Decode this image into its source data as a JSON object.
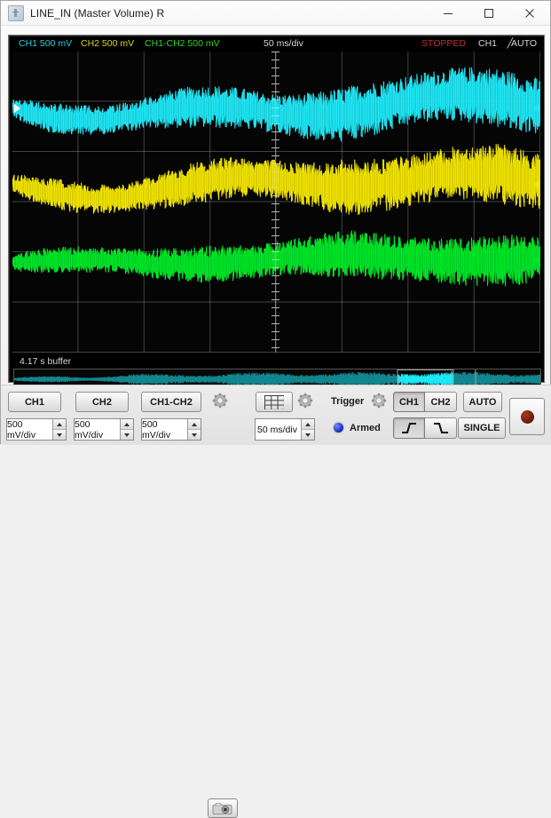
{
  "window": {
    "title": "LINE_IN (Master Volume) R",
    "icon": "app-icon",
    "minimize": "−",
    "maximize": "□",
    "close": "✕"
  },
  "scope": {
    "readout": {
      "ch1": "CH1 500 mV",
      "ch2": "CH2 500 mV",
      "diff": "CH1-CH2 500 mV",
      "timebase": "50 ms/div",
      "status": "STOPPED",
      "trigger_source": "CH1",
      "trigger_slope": "╱",
      "trigger_mode": "AUTO"
    },
    "colors": {
      "ch1": "#1fe7f5",
      "ch2": "#f2e500",
      "diff": "#00e828",
      "status": "#c03030",
      "background": "#050505",
      "grid": "#969696"
    },
    "buffer_label": "4.17 s buffer"
  },
  "controls": {
    "ch1_button": "CH1",
    "ch2_button": "CH2",
    "diff_button": "CH1-CH2",
    "ch1_scale": "500 mV/div",
    "ch2_scale": "500 mV/div",
    "diff_scale": "500 mV/div",
    "timebase_value": "50 ms/div",
    "trigger_label": "Trigger",
    "armed_label": "Armed",
    "trig_ch1": "CH1",
    "trig_ch2": "CH2",
    "auto_button": "AUTO",
    "single_button": "SINGLE",
    "record_button": "record",
    "display_gear": "gear-icon",
    "trigger_gear": "gear-icon",
    "camera_button": "camera-icon",
    "grid_button": "grid-icon",
    "slope_rising": "rising-edge",
    "slope_falling": "falling-edge"
  }
}
